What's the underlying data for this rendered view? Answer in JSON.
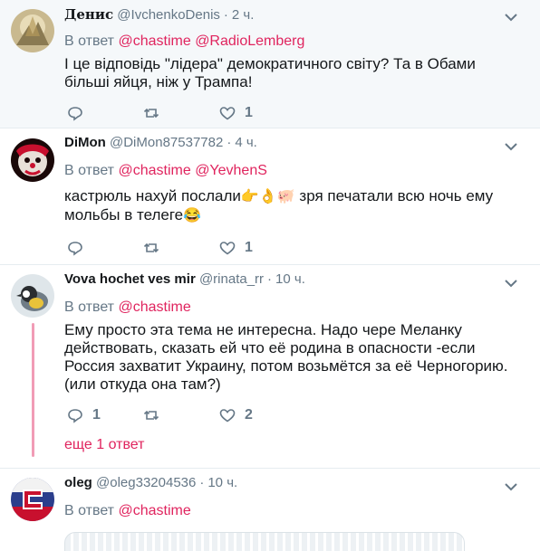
{
  "tweets": [
    {
      "name": "Денис",
      "handle": "@IvchenkoDenis",
      "time": "2 ч.",
      "reply_prefix": "В ответ",
      "mentions": [
        "@chastime",
        "@RadioLemberg"
      ],
      "lines": [
        "І це відповідь \"лідера\" демократичного світу? Та в Обами",
        "більші яйця, ніж у Трампа!"
      ],
      "replies": "",
      "retweets": "",
      "likes": "1"
    },
    {
      "name": "DiMon",
      "handle": "@DiMon87537782",
      "time": "4 ч.",
      "reply_prefix": "В ответ",
      "mentions": [
        "@chastime",
        "@YevhenS"
      ],
      "line1_a": "кастрюль нахуй послали",
      "line1_emoji": "👉👌🐖",
      "line1_b": " зря печатали всю ночь ему",
      "line2": "мольбы в телеге",
      "line2_emoji": "😂",
      "replies": "",
      "retweets": "",
      "likes": "1"
    },
    {
      "name": "Vova hochet ves mir",
      "handle": "@rinata_rr",
      "time": "10 ч.",
      "reply_prefix": "В ответ",
      "mentions": [
        "@chastime"
      ],
      "lines": [
        "Ему просто эта тема не интересна. Надо чере Меланку",
        "действовать, сказать ей что её родина в опасности  -если",
        "Россия захватит Украину,  потом возьмётся за её Черногорию.",
        "(или откуда она там?)"
      ],
      "replies": "1",
      "retweets": "",
      "likes": "2",
      "more_replies": "еще 1 ответ"
    },
    {
      "name": "oleg",
      "handle": "@oleg33204536",
      "time": "10 ч.",
      "reply_prefix": "В ответ",
      "mentions": [
        "@chastime"
      ]
    }
  ],
  "icons": {
    "reply": "reply-icon",
    "retweet": "retweet-icon",
    "like": "heart-icon",
    "menu": "chevron-down-icon"
  },
  "colors": {
    "accent": "#e0245e",
    "muted": "#657786",
    "border": "#e6ecf0",
    "highlight_bg": "#f5f8fa"
  }
}
